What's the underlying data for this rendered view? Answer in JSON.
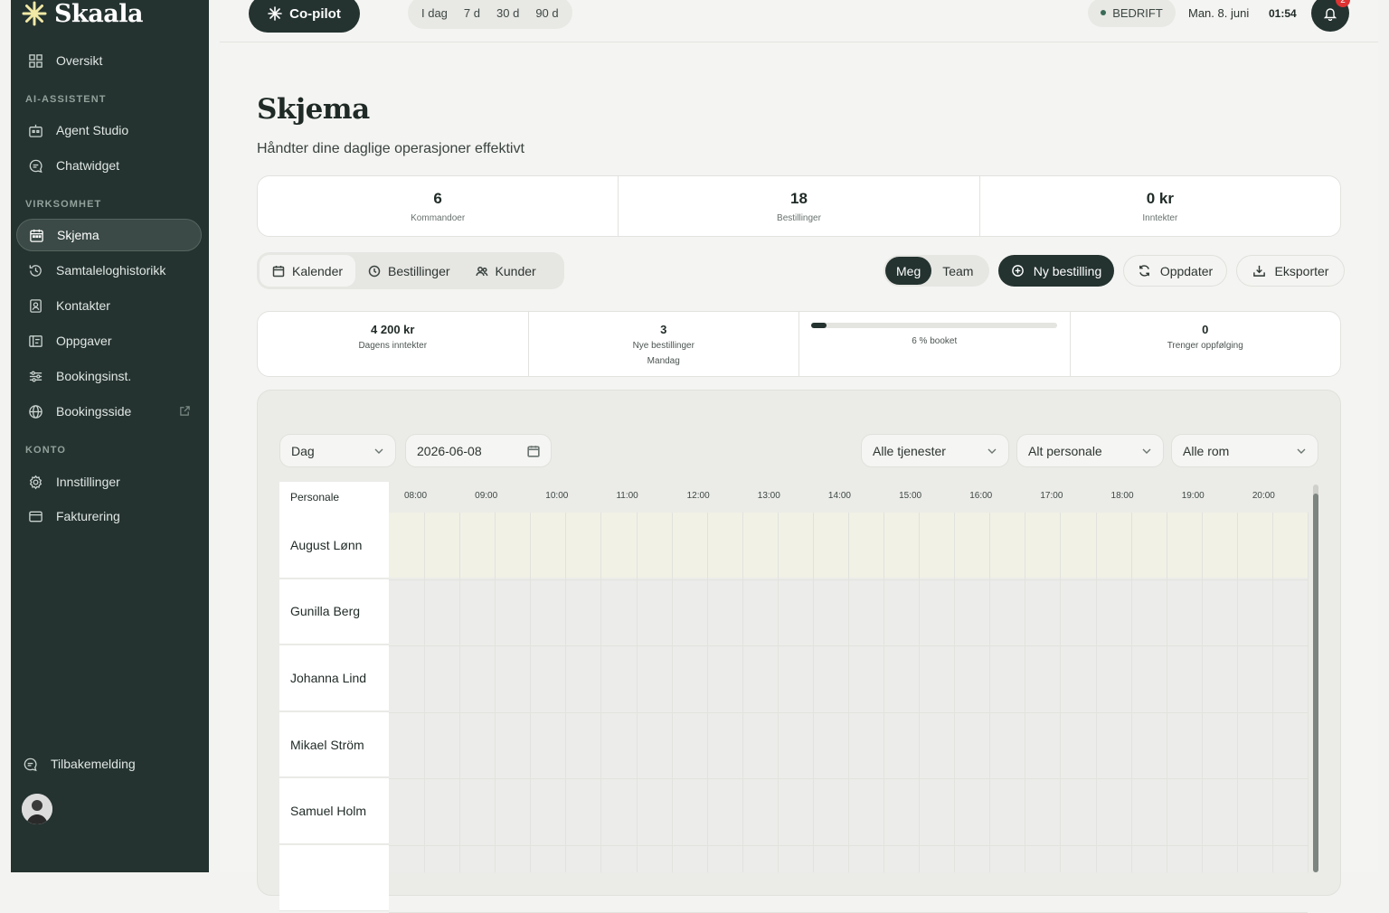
{
  "sidebar": {
    "logo": "Skaala",
    "overview": "Oversikt",
    "sections": {
      "ai": "AI-ASSISTENT",
      "business": "VIRKSOMHET",
      "account": "KONTO"
    },
    "items": [
      {
        "label": "Agent Studio",
        "icon": "robot-icon"
      },
      {
        "label": "Chatwidget",
        "icon": "chat-icon"
      },
      {
        "label": "Skjema",
        "icon": "calendar-icon",
        "active": true
      },
      {
        "label": "Samtaleloghistorikk",
        "icon": "history-icon"
      },
      {
        "label": "Kontakter",
        "icon": "contact-icon"
      },
      {
        "label": "Oppgaver",
        "icon": "tasks-icon"
      },
      {
        "label": "Bookingsinst.",
        "icon": "sliders-icon"
      },
      {
        "label": "Bookingsside",
        "icon": "globe-icon"
      },
      {
        "label": "Innstillinger",
        "icon": "gear-icon"
      },
      {
        "label": "Fakturering",
        "icon": "card-icon"
      }
    ],
    "feedback": "Tilbakemelding"
  },
  "topbar": {
    "copilot": "Co-pilot",
    "ranges": [
      "I dag",
      "7 d",
      "30 d",
      "90 d"
    ],
    "mode": "BEDRIFT",
    "date": "Man. 8. juni",
    "time": "01:54",
    "notifications": "2"
  },
  "page": {
    "title": "Skjema",
    "subtitle": "Håndter dine daglige operasjoner effektivt"
  },
  "stats": [
    {
      "value": "6",
      "label": "Kommandoer"
    },
    {
      "value": "18",
      "label": "Bestillinger"
    },
    {
      "value": "0 kr",
      "label": "Inntekter"
    }
  ],
  "tabs": [
    "Kalender",
    "Bestillinger",
    "Kunder"
  ],
  "scope": [
    "Meg",
    "Team"
  ],
  "actions": {
    "new": "Ny bestilling",
    "refresh": "Oppdater",
    "export": "Eksporter"
  },
  "metrics": {
    "revenue": {
      "value": "4 200 kr",
      "label": "Dagens inntekter"
    },
    "new_orders": {
      "value": "3",
      "label": "Nye bestillinger",
      "sub": "Mandag"
    },
    "booked": {
      "label": "6 % booket",
      "fraction": 0.06
    },
    "followup": {
      "value": "0",
      "label": "Trenger oppfølging"
    }
  },
  "filters": {
    "view": "Dag",
    "date": "2026-06-08",
    "services": "Alle tjenester",
    "staff": "Alt personale",
    "rooms": "Alle rom"
  },
  "schedule": {
    "header": "Personale",
    "hours": [
      "08:00",
      "09:00",
      "10:00",
      "11:00",
      "12:00",
      "13:00",
      "14:00",
      "15:00",
      "16:00",
      "17:00",
      "18:00",
      "19:00",
      "20:00"
    ],
    "staff": [
      "August Lønn",
      "Gunilla Berg",
      "Johanna Lind",
      "Mikael Ström",
      "Samuel Holm",
      ""
    ]
  },
  "colors": {
    "sidebar": "#243330",
    "accent": "#243330",
    "page": "#f4f4f2"
  }
}
